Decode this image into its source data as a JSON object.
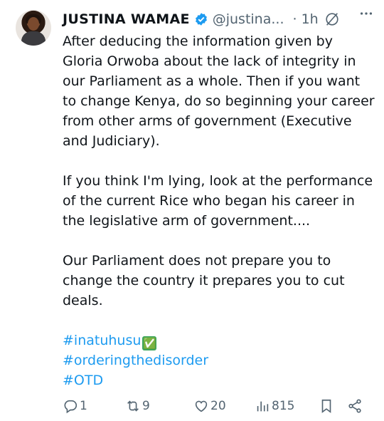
{
  "author": {
    "name": "JUSTINA WAMAE",
    "handle": "@justina...",
    "time": "· 1h"
  },
  "tweet": {
    "paragraphs": [
      "After deducing the information given by Gloria  Orwoba about the lack of integrity in our Parliament as a whole. Then if you want to change Kenya, do so beginning your career from other arms of government (Executive and Judiciary).",
      "If you think I'm lying, look at the performance of the current Rice who began his career in the legislative arm of government....",
      "Our Parliament does not prepare you to change the country it prepares you to cut deals."
    ],
    "hashtags": [
      "#inatuhusu",
      "#orderingthedisorder",
      "#OTD"
    ],
    "hashtag_emoji": "✅"
  },
  "actions": {
    "replies": "1",
    "reposts": "9",
    "likes": "20",
    "views": "815"
  },
  "colors": {
    "link": "#1d9bf0",
    "text": "#0f1419",
    "muted": "#536471"
  }
}
